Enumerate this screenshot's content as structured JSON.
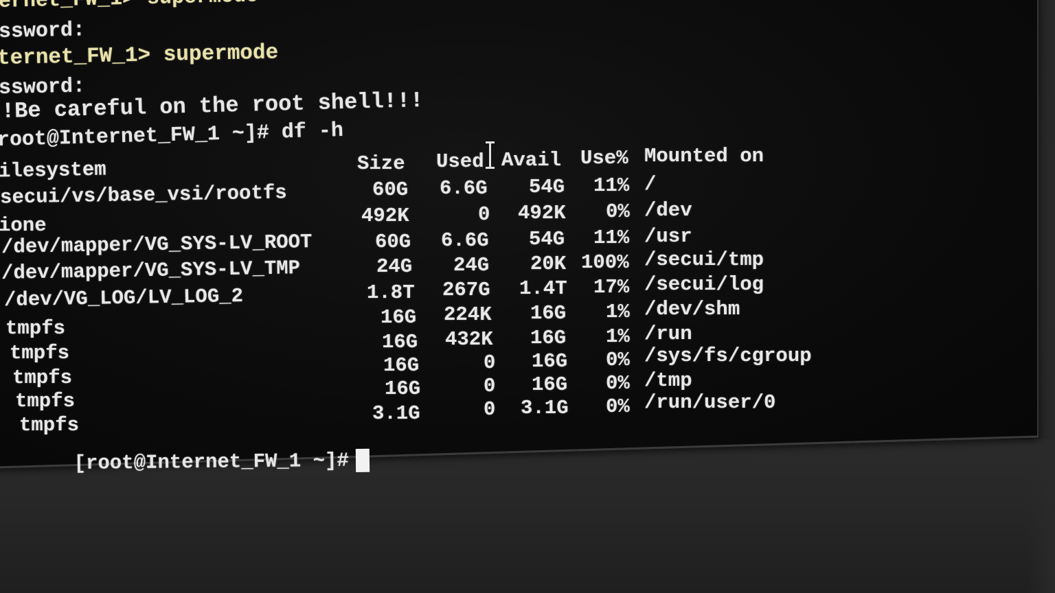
{
  "terminal": {
    "lines": [
      "ernet_FW_1> supermode",
      "ssword:",
      "ternet_FW_1> supermode",
      "ssword:",
      "!Be careful on the root shell!!!",
      "root@Internet_FW_1 ~]# df -h"
    ],
    "prompt": "[root@Internet_FW_1 ~]#"
  },
  "df": {
    "headers": {
      "filesystem": "ilesystem",
      "size": "Size",
      "used": "Used",
      "avail": "Avail",
      "use_pct": "Use%",
      "mounted": "Mounted on"
    },
    "rows": [
      {
        "fs": "secui/vs/base_vsi/rootfs",
        "size": "60G",
        "used": "6.6G",
        "avail": "54G",
        "pct": "11%",
        "mount": "/"
      },
      {
        "fs": "ione",
        "size": "492K",
        "used": "0",
        "avail": "492K",
        "pct": "0%",
        "mount": "/dev"
      },
      {
        "fs": "/dev/mapper/VG_SYS-LV_ROOT",
        "size": "60G",
        "used": "6.6G",
        "avail": "54G",
        "pct": "11%",
        "mount": "/usr"
      },
      {
        "fs": "/dev/mapper/VG_SYS-LV_TMP",
        "size": "24G",
        "used": "24G",
        "avail": "20K",
        "pct": "100%",
        "mount": "/secui/tmp"
      },
      {
        "fs": "/dev/VG_LOG/LV_LOG_2",
        "size": "1.8T",
        "used": "267G",
        "avail": "1.4T",
        "pct": "17%",
        "mount": "/secui/log"
      },
      {
        "fs": "tmpfs",
        "size": "16G",
        "used": "224K",
        "avail": "16G",
        "pct": "1%",
        "mount": "/dev/shm"
      },
      {
        "fs": "tmpfs",
        "size": "16G",
        "used": "432K",
        "avail": "16G",
        "pct": "1%",
        "mount": "/run"
      },
      {
        "fs": "tmpfs",
        "size": "16G",
        "used": "0",
        "avail": "16G",
        "pct": "0%",
        "mount": "/sys/fs/cgroup"
      },
      {
        "fs": "tmpfs",
        "size": "16G",
        "used": "0",
        "avail": "16G",
        "pct": "0%",
        "mount": "/tmp"
      },
      {
        "fs": "tmpfs",
        "size": "3.1G",
        "used": "0",
        "avail": "3.1G",
        "pct": "0%",
        "mount": "/run/user/0"
      }
    ]
  }
}
